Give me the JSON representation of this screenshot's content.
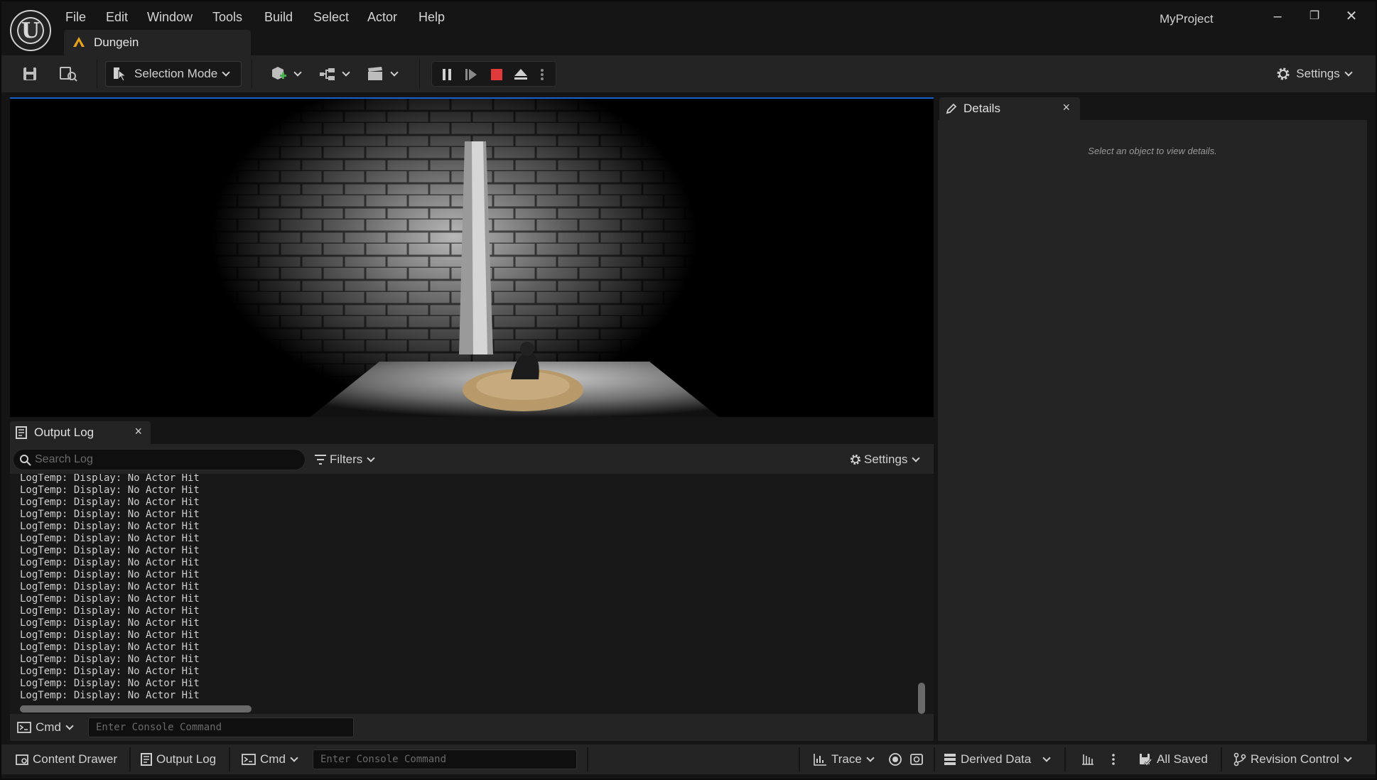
{
  "window": {
    "project_name": "MyProject",
    "document_tab": "Dungein"
  },
  "menu": [
    "File",
    "Edit",
    "Window",
    "Tools",
    "Build",
    "Select",
    "Actor",
    "Help"
  ],
  "toolbar": {
    "selection_mode_label": "Selection Mode",
    "settings_label": "Settings"
  },
  "details": {
    "tab_label": "Details",
    "hint": "Select an object to view details."
  },
  "output_log": {
    "tab_label": "Output Log",
    "search_placeholder": "Search Log",
    "filters_label": "Filters",
    "settings_label": "Settings",
    "lines": [
      "LogTemp: Display: No Actor Hit",
      "LogTemp: Display: No Actor Hit",
      "LogTemp: Display: No Actor Hit",
      "LogTemp: Display: No Actor Hit",
      "LogTemp: Display: No Actor Hit",
      "LogTemp: Display: No Actor Hit",
      "LogTemp: Display: No Actor Hit",
      "LogTemp: Display: No Actor Hit",
      "LogTemp: Display: No Actor Hit",
      "LogTemp: Display: No Actor Hit",
      "LogTemp: Display: No Actor Hit",
      "LogTemp: Display: No Actor Hit",
      "LogTemp: Display: No Actor Hit",
      "LogTemp: Display: No Actor Hit",
      "LogTemp: Display: No Actor Hit",
      "LogTemp: Display: No Actor Hit",
      "LogTemp: Display: No Actor Hit",
      "LogTemp: Display: No Actor Hit",
      "LogTemp: Display: No Actor Hit"
    ],
    "cmd_label": "Cmd",
    "console_placeholder": "Enter Console Command"
  },
  "statusbar": {
    "content_drawer": "Content Drawer",
    "output_log": "Output Log",
    "cmd_label": "Cmd",
    "console_placeholder": "Enter Console Command",
    "trace_label": "Trace",
    "derived_data_label": "Derived Data",
    "all_saved_label": "All Saved",
    "revision_control_label": "Revision Control"
  },
  "colors": {
    "stop_button": "#e03a3a",
    "viewport_accent": "#1a5fd0",
    "dungeon_icon": "#e8a21c"
  }
}
